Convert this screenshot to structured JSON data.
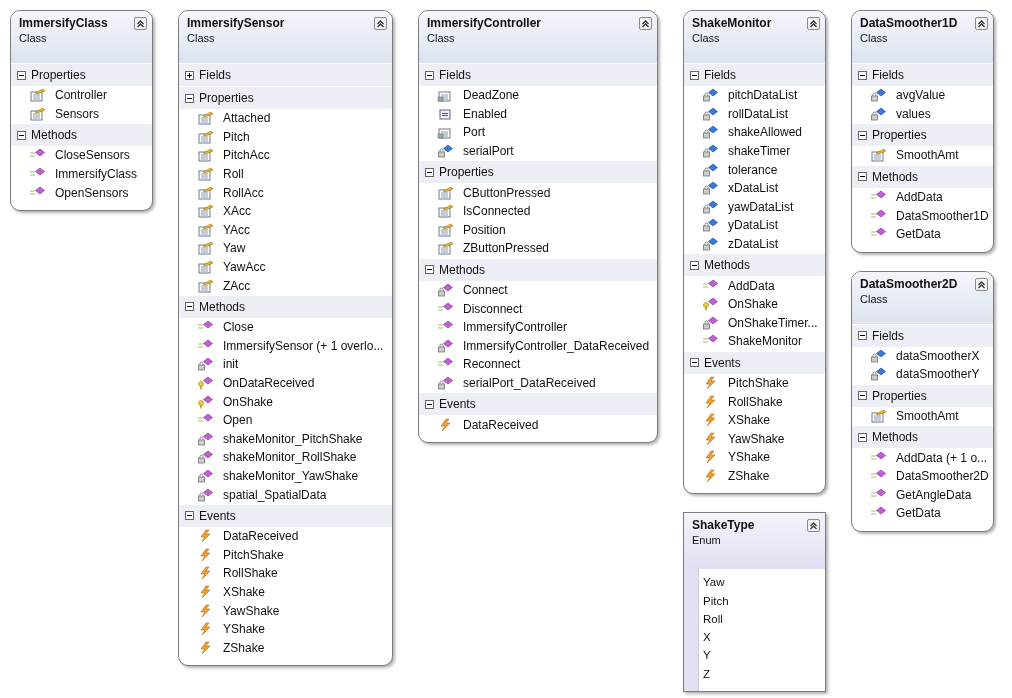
{
  "classes": [
    {
      "name": "ImmersifyClass",
      "type": "Class",
      "kind": "class",
      "sections": [
        {
          "name": "Properties",
          "expanded": true,
          "members": [
            {
              "name": "Controller",
              "kind": "property"
            },
            {
              "name": "Sensors",
              "kind": "property"
            }
          ]
        },
        {
          "name": "Methods",
          "expanded": true,
          "members": [
            {
              "name": "CloseSensors",
              "kind": "method"
            },
            {
              "name": "ImmersifyClass",
              "kind": "method"
            },
            {
              "name": "OpenSensors",
              "kind": "method"
            }
          ]
        }
      ]
    },
    {
      "name": "ImmersifySensor",
      "type": "Class",
      "kind": "class",
      "sections": [
        {
          "name": "Fields",
          "expanded": false
        },
        {
          "name": "Properties",
          "expanded": true,
          "members": [
            {
              "name": "Attached",
              "kind": "property"
            },
            {
              "name": "Pitch",
              "kind": "property"
            },
            {
              "name": "PitchAcc",
              "kind": "property"
            },
            {
              "name": "Roll",
              "kind": "property"
            },
            {
              "name": "RollAcc",
              "kind": "property"
            },
            {
              "name": "XAcc",
              "kind": "property"
            },
            {
              "name": "YAcc",
              "kind": "property"
            },
            {
              "name": "Yaw",
              "kind": "property"
            },
            {
              "name": "YawAcc",
              "kind": "property"
            },
            {
              "name": "ZAcc",
              "kind": "property"
            }
          ]
        },
        {
          "name": "Methods",
          "expanded": true,
          "members": [
            {
              "name": "Close",
              "kind": "method"
            },
            {
              "name": "ImmersifySensor (+ 1 overlo...",
              "kind": "method"
            },
            {
              "name": "init",
              "kind": "private-method"
            },
            {
              "name": "OnDataReceived",
              "kind": "protected-method"
            },
            {
              "name": "OnShake",
              "kind": "protected-method"
            },
            {
              "name": "Open",
              "kind": "method"
            },
            {
              "name": "shakeMonitor_PitchShake",
              "kind": "private-method"
            },
            {
              "name": "shakeMonitor_RollShake",
              "kind": "private-method"
            },
            {
              "name": "shakeMonitor_YawShake",
              "kind": "private-method"
            },
            {
              "name": "spatial_SpatialData",
              "kind": "private-method"
            }
          ]
        },
        {
          "name": "Events",
          "expanded": true,
          "members": [
            {
              "name": "DataReceived",
              "kind": "event"
            },
            {
              "name": "PitchShake",
              "kind": "event"
            },
            {
              "name": "RollShake",
              "kind": "event"
            },
            {
              "name": "XShake",
              "kind": "event"
            },
            {
              "name": "YawShake",
              "kind": "event"
            },
            {
              "name": "YShake",
              "kind": "event"
            },
            {
              "name": "ZShake",
              "kind": "event"
            }
          ]
        }
      ]
    },
    {
      "name": "ImmersifyController",
      "type": "Class",
      "kind": "class",
      "sections": [
        {
          "name": "Fields",
          "expanded": true,
          "members": [
            {
              "name": "DeadZone",
              "kind": "private-constant"
            },
            {
              "name": "Enabled",
              "kind": "field"
            },
            {
              "name": "Port",
              "kind": "private-constant"
            },
            {
              "name": "serialPort",
              "kind": "private-field"
            }
          ]
        },
        {
          "name": "Properties",
          "expanded": true,
          "members": [
            {
              "name": "CButtonPressed",
              "kind": "property"
            },
            {
              "name": "IsConnected",
              "kind": "property"
            },
            {
              "name": "Position",
              "kind": "property"
            },
            {
              "name": "ZButtonPressed",
              "kind": "property"
            }
          ]
        },
        {
          "name": "Methods",
          "expanded": true,
          "members": [
            {
              "name": "Connect",
              "kind": "private-method"
            },
            {
              "name": "Disconnect",
              "kind": "method"
            },
            {
              "name": "ImmersifyController",
              "kind": "method"
            },
            {
              "name": "ImmersifyController_DataReceived",
              "kind": "private-method"
            },
            {
              "name": "Reconnect",
              "kind": "method"
            },
            {
              "name": "serialPort_DataReceived",
              "kind": "private-method"
            }
          ]
        },
        {
          "name": "Events",
          "expanded": true,
          "members": [
            {
              "name": "DataReceived",
              "kind": "event"
            }
          ]
        }
      ]
    },
    {
      "name": "ShakeMonitor",
      "type": "Class",
      "kind": "class",
      "sections": [
        {
          "name": "Fields",
          "expanded": true,
          "members": [
            {
              "name": "pitchDataList",
              "kind": "private-field"
            },
            {
              "name": "rollDataList",
              "kind": "private-field"
            },
            {
              "name": "shakeAllowed",
              "kind": "private-field"
            },
            {
              "name": "shakeTimer",
              "kind": "private-field"
            },
            {
              "name": "tolerance",
              "kind": "private-field"
            },
            {
              "name": "xDataList",
              "kind": "private-field"
            },
            {
              "name": "yawDataList",
              "kind": "private-field"
            },
            {
              "name": "yDataList",
              "kind": "private-field"
            },
            {
              "name": "zDataList",
              "kind": "private-field"
            }
          ]
        },
        {
          "name": "Methods",
          "expanded": true,
          "members": [
            {
              "name": "AddData",
              "kind": "method"
            },
            {
              "name": "OnShake",
              "kind": "protected-method"
            },
            {
              "name": "OnShakeTimer...",
              "kind": "private-method"
            },
            {
              "name": "ShakeMonitor",
              "kind": "method"
            }
          ]
        },
        {
          "name": "Events",
          "expanded": true,
          "members": [
            {
              "name": "PitchShake",
              "kind": "event"
            },
            {
              "name": "RollShake",
              "kind": "event"
            },
            {
              "name": "XShake",
              "kind": "event"
            },
            {
              "name": "YawShake",
              "kind": "event"
            },
            {
              "name": "YShake",
              "kind": "event"
            },
            {
              "name": "ZShake",
              "kind": "event"
            }
          ]
        }
      ]
    },
    {
      "name": "ShakeType",
      "type": "Enum",
      "kind": "enum",
      "values": [
        "Yaw",
        "Pitch",
        "Roll",
        "X",
        "Y",
        "Z"
      ]
    },
    {
      "name": "DataSmoother1D",
      "type": "Class",
      "kind": "class",
      "sections": [
        {
          "name": "Fields",
          "expanded": true,
          "members": [
            {
              "name": "avgValue",
              "kind": "private-field"
            },
            {
              "name": "values",
              "kind": "private-field"
            }
          ]
        },
        {
          "name": "Properties",
          "expanded": true,
          "members": [
            {
              "name": "SmoothAmt",
              "kind": "property"
            }
          ]
        },
        {
          "name": "Methods",
          "expanded": true,
          "members": [
            {
              "name": "AddData",
              "kind": "method"
            },
            {
              "name": "DataSmoother1D",
              "kind": "method"
            },
            {
              "name": "GetData",
              "kind": "method"
            }
          ]
        }
      ]
    },
    {
      "name": "DataSmoother2D",
      "type": "Class",
      "kind": "class",
      "sections": [
        {
          "name": "Fields",
          "expanded": true,
          "members": [
            {
              "name": "dataSmootherX",
              "kind": "private-field"
            },
            {
              "name": "dataSmootherY",
              "kind": "private-field"
            }
          ]
        },
        {
          "name": "Properties",
          "expanded": true,
          "members": [
            {
              "name": "SmoothAmt",
              "kind": "property"
            }
          ]
        },
        {
          "name": "Methods",
          "expanded": true,
          "members": [
            {
              "name": "AddData (+ 1 o...",
              "kind": "method"
            },
            {
              "name": "DataSmoother2D",
              "kind": "method"
            },
            {
              "name": "GetAngleData",
              "kind": "method"
            },
            {
              "name": "GetData",
              "kind": "method"
            }
          ]
        }
      ]
    }
  ]
}
